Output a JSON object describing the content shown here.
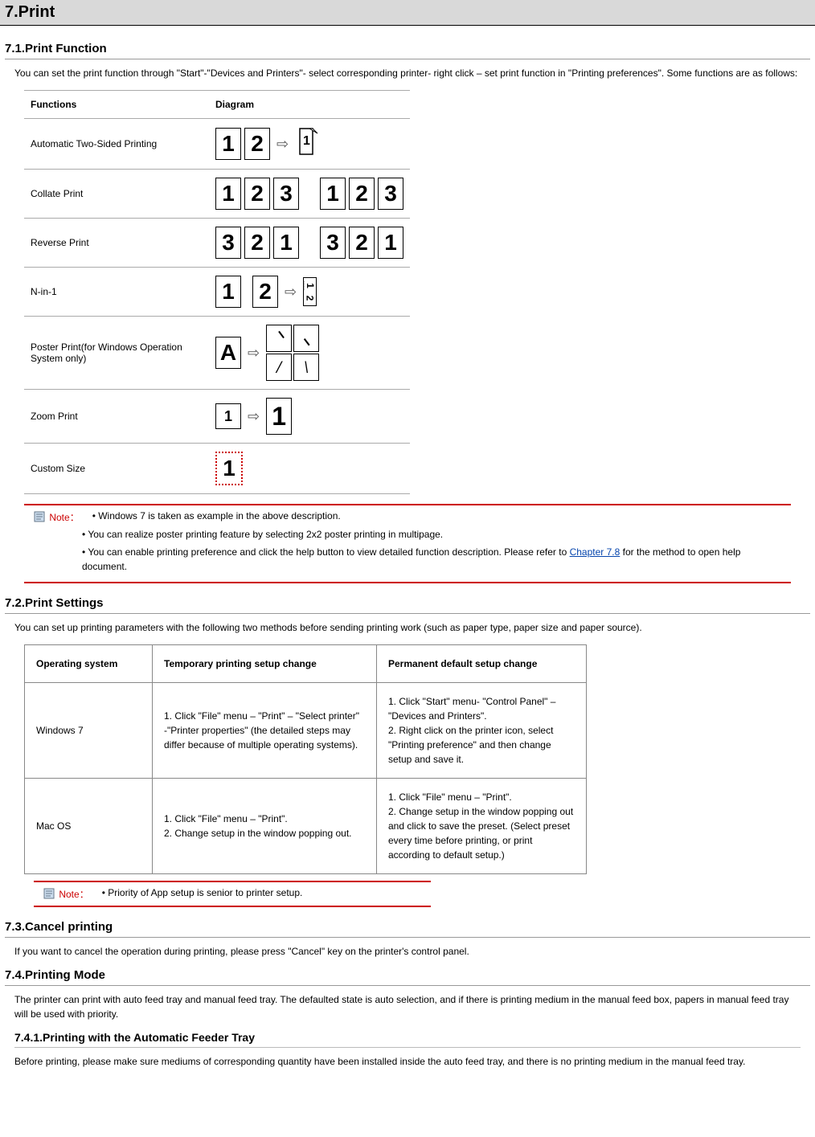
{
  "title": "7.Print",
  "sections": {
    "s71": {
      "title": "7.1.Print Function",
      "intro": "You can set the print function through \"Start\"-\"Devices and Printers\"- select corresponding printer- right click – set print function in \"Printing preferences\". Some functions are as follows:",
      "table": {
        "headers": {
          "c1": "Functions",
          "c2": "Diagram"
        },
        "rows": {
          "r1": "Automatic Two-Sided Printing",
          "r2": "Collate Print",
          "r3": "Reverse Print",
          "r4": "N-in-1",
          "r5": "Poster Print(for Windows Operation System only)",
          "r6": "Zoom Print",
          "r7": "Custom Size"
        }
      },
      "note_label": "Note：",
      "notes": {
        "n1": "• Windows 7 is taken as example in the above description.",
        "n2": "• You can realize poster printing feature by selecting 2x2 poster printing in multipage.",
        "n3_a": "• You can enable printing preference and click the help button to view detailed function description. Please refer to ",
        "n3_link": "Chapter 7.8",
        "n3_b": " for the method to open help document."
      }
    },
    "s72": {
      "title": "7.2.Print Settings",
      "intro": "You can set up printing parameters with the following two methods before sending printing work (such as paper type, paper size and paper source).",
      "table": {
        "headers": {
          "c1": "Operating system",
          "c2": "Temporary printing setup change",
          "c3": "Permanent default setup change"
        },
        "rows": {
          "r1": {
            "os": "Windows 7",
            "temp": "1. Click \"File\" menu – \"Print\" – \"Select printer\" -\"Printer properties\" (the detailed steps may differ because of multiple operating systems).",
            "perm": "1. Click \"Start\" menu- \"Control Panel\" – \"Devices and Printers\".\n2. Right click on the printer icon, select \"Printing preference\" and then change setup and save it."
          },
          "r2": {
            "os": "Mac OS",
            "temp": "1. Click \"File\" menu – \"Print\".\n2. Change setup in the window popping out.",
            "perm": "1. Click \"File\" menu – \"Print\".\n2. Change setup in the window popping out and click to save the preset. (Select preset every time before printing, or print according to default setup.)"
          }
        }
      },
      "note_label": "Note：",
      "note": "• Priority of App setup is senior to printer setup."
    },
    "s73": {
      "title": "7.3.Cancel printing",
      "intro": "If you want to cancel the operation during printing, please press \"Cancel\" key on the printer's control panel."
    },
    "s74": {
      "title": "7.4.Printing Mode",
      "intro": "The printer can print with auto feed tray and manual feed tray. The defaulted state is auto selection, and if there is printing medium in the manual feed box, papers in manual feed tray will be used with priority.",
      "sub": {
        "title": "7.4.1.Printing with the Automatic Feeder Tray",
        "intro": "Before printing, please make sure mediums of corresponding quantity have been installed inside the auto feed tray, and there is no printing medium in the manual feed tray."
      }
    }
  }
}
